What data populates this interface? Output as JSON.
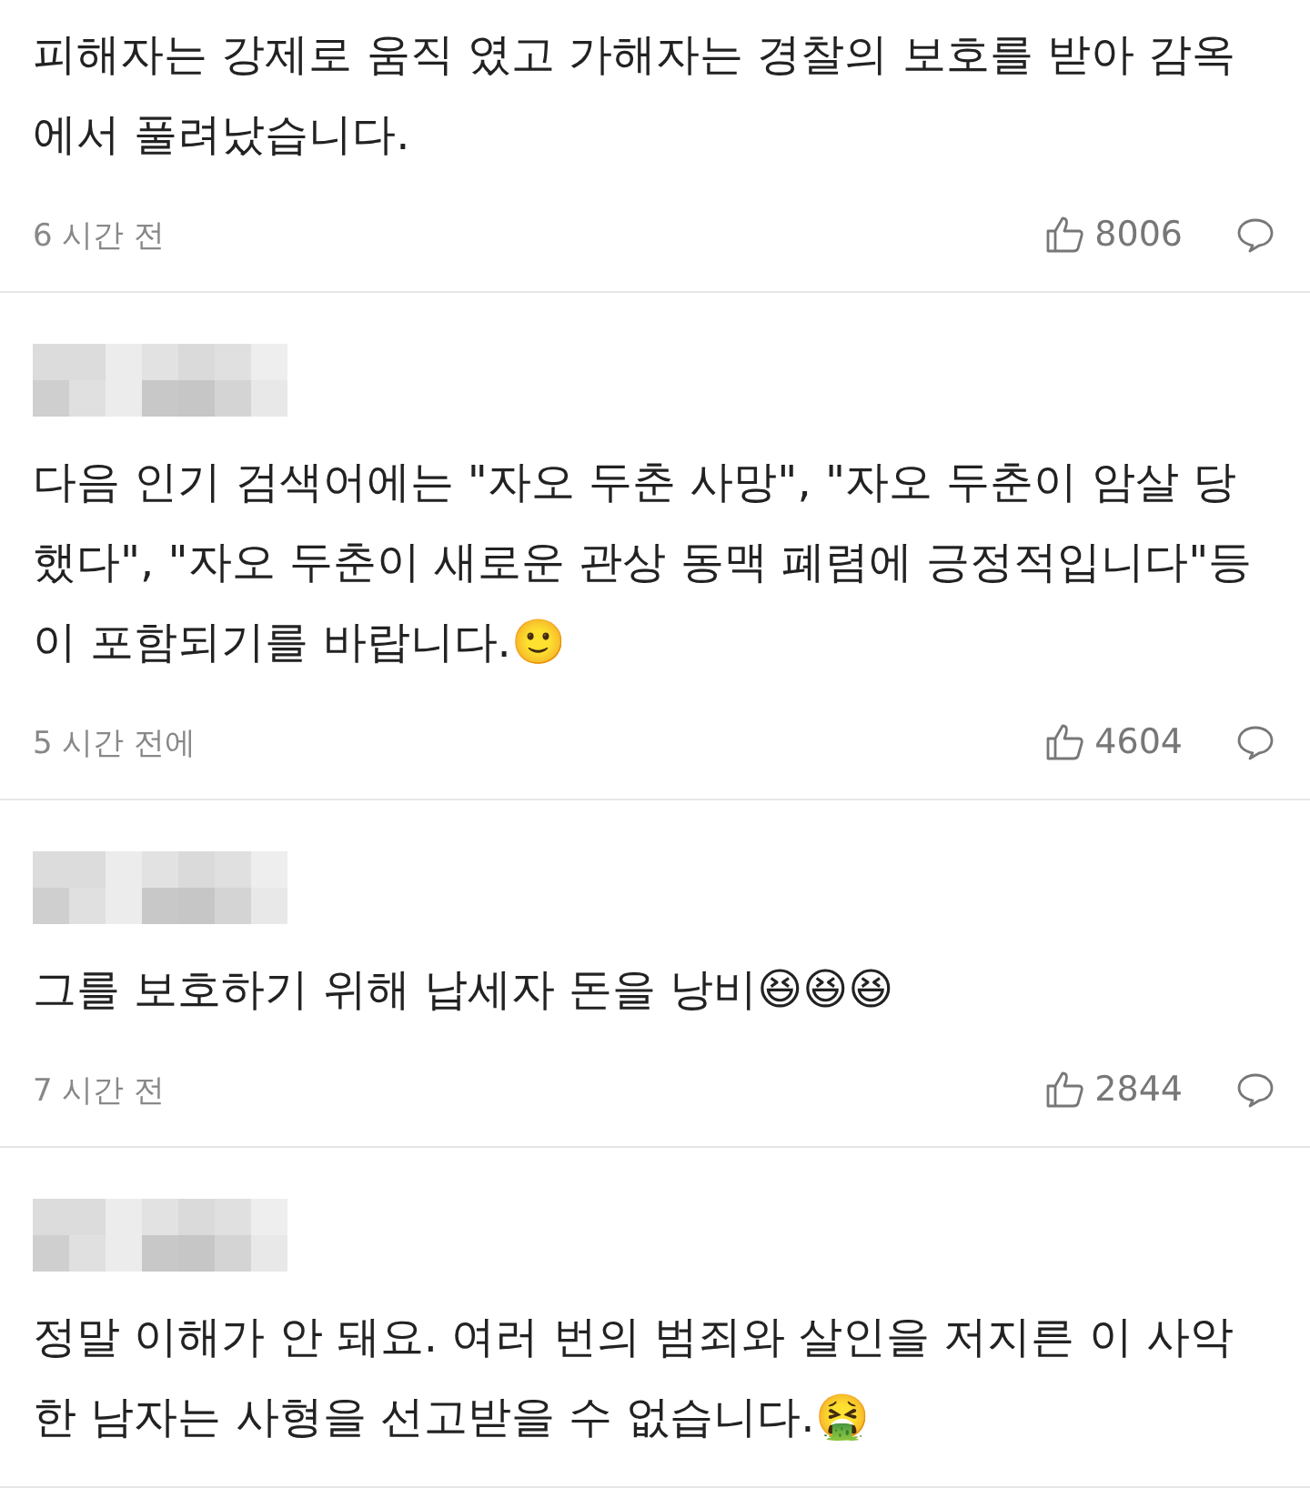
{
  "comments": [
    {
      "author_blurred": false,
      "text": "피해자는 강제로 움직 였고 가해자는 경찰의 보호를 받아 감옥에서 풀려났습니다.",
      "time": "6 시간 전",
      "likes": "8006"
    },
    {
      "author_blurred": true,
      "text": "다음 인기 검색어에는 \"자오 두춘 사망\", \"자오 두춘이 암살 당했다\", \"자오 두춘이 새로운 관상 동맥 폐렴에 긍정적입니다\"등이 포함되기를 바랍니다.🙂",
      "time": "5 시간 전에",
      "likes": "4604"
    },
    {
      "author_blurred": true,
      "text": "그를 보호하기 위해 납세자 돈을 낭비😆😆😆",
      "time": "7 시간 전",
      "likes": "2844"
    },
    {
      "author_blurred": true,
      "text": "정말 이해가 안 돼요. 여러 번의 범죄와 살인을 저지른 이 사악한 남자는 사형을 선고받을 수 없습니다.🤮"
    }
  ]
}
